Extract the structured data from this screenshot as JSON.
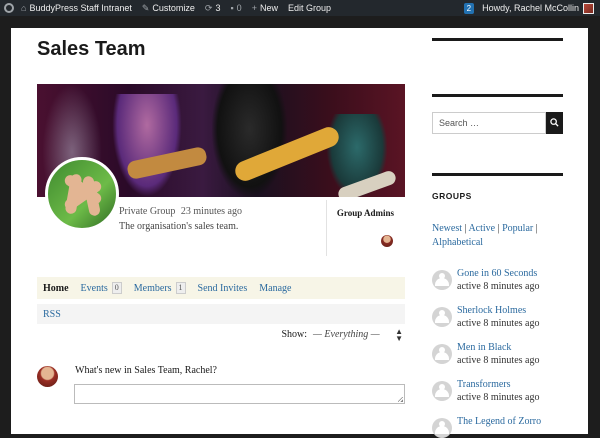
{
  "adminbar": {
    "site_name": "BuddyPress Staff Intranet",
    "customize": "Customize",
    "updates_count": "3",
    "comments_count": "0",
    "new_label": "New",
    "edit_group": "Edit Group",
    "notifications_count": "2",
    "howdy": "Howdy, Rachel McCollin"
  },
  "group": {
    "title": "Sales Team",
    "status": "Private Group",
    "active": "23 minutes ago",
    "description": "The organisation's sales team.",
    "admins_title": "Group Admins"
  },
  "nav": {
    "home": "Home",
    "events": "Events",
    "events_count": "0",
    "members": "Members",
    "members_count": "1",
    "send_invites": "Send Invites",
    "manage": "Manage"
  },
  "subnav": {
    "rss": "RSS"
  },
  "filter": {
    "label": "Show:",
    "selected": "— Everything —"
  },
  "post_form": {
    "prompt": "What's new in Sales Team, Rachel?"
  },
  "sidebar": {
    "search_placeholder": "Search …",
    "widget_title": "GROUPS",
    "filters": [
      "Newest",
      "Active",
      "Popular",
      "Alphabetical"
    ],
    "groups": [
      {
        "name": "Gone in 60 Seconds",
        "time": "active 8 minutes ago"
      },
      {
        "name": "Sherlock Holmes",
        "time": "active 8 minutes ago"
      },
      {
        "name": "Men in Black",
        "time": "active 8 minutes ago"
      },
      {
        "name": "Transformers",
        "time": "active 8 minutes ago"
      },
      {
        "name": "The Legend of Zorro",
        "time": ""
      }
    ]
  },
  "colors": {
    "link": "#2b6a9f",
    "adminbar": "#23282d",
    "nav_bg": "#f7f5e7"
  }
}
